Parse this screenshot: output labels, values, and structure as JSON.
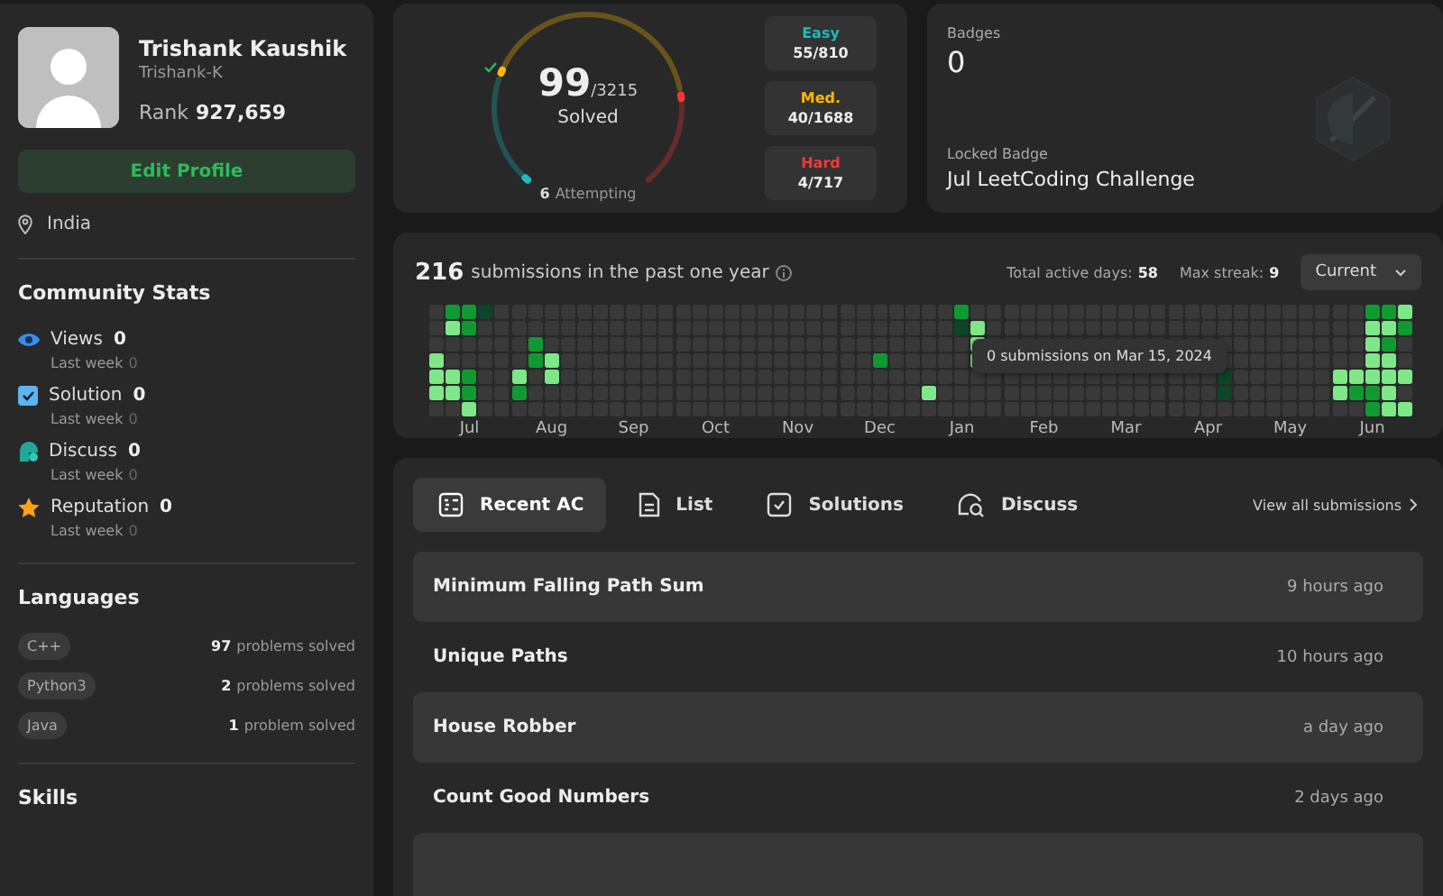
{
  "profile": {
    "name": "Trishank Kaushik",
    "username": "Trishank-K",
    "rank_label": "Rank",
    "rank": "927,659",
    "edit_button": "Edit Profile",
    "location": "India"
  },
  "community_stats": {
    "title": "Community Stats",
    "items": [
      {
        "kind": "views",
        "label": "Views",
        "value": "0",
        "sub_label": "Last week",
        "sub_value": "0"
      },
      {
        "kind": "solution",
        "label": "Solution",
        "value": "0",
        "sub_label": "Last week",
        "sub_value": "0"
      },
      {
        "kind": "discuss",
        "label": "Discuss",
        "value": "0",
        "sub_label": "Last week",
        "sub_value": "0"
      },
      {
        "kind": "reputation",
        "label": "Reputation",
        "value": "0",
        "sub_label": "Last week",
        "sub_value": "0"
      }
    ]
  },
  "languages": {
    "title": "Languages",
    "items": [
      {
        "name": "C++",
        "count": "97",
        "suffix": "problems solved"
      },
      {
        "name": "Python3",
        "count": "2",
        "suffix": "problems solved"
      },
      {
        "name": "Java",
        "count": "1",
        "suffix": "problem solved"
      }
    ]
  },
  "skills": {
    "title": "Skills"
  },
  "solved": {
    "count": "99",
    "total": "/3215",
    "label": "Solved",
    "attempting_count": "6",
    "attempting_label": "Attempting",
    "difficulties": [
      {
        "label": "Easy",
        "value": "55/810",
        "color": "#1cbbba"
      },
      {
        "label": "Med.",
        "value": "40/1688",
        "color": "#ffb800"
      },
      {
        "label": "Hard",
        "value": "4/717",
        "color": "#f63737"
      }
    ]
  },
  "badges": {
    "title": "Badges",
    "count": "0",
    "locked_label": "Locked Badge",
    "locked_name": "Jul LeetCoding Challenge"
  },
  "submissions": {
    "count": "216",
    "text": "submissions in the past one year",
    "active_days_label": "Total active days:",
    "active_days": "58",
    "max_streak_label": "Max streak:",
    "max_streak": "9",
    "period": "Current",
    "tooltip": "0 submissions on Mar 15, 2024",
    "months": [
      {
        "label": "Jul"
      },
      {
        "label": "Aug"
      },
      {
        "label": "Sep"
      },
      {
        "label": "Oct"
      },
      {
        "label": "Nov"
      },
      {
        "label": "Dec"
      },
      {
        "label": "Jan"
      },
      {
        "label": "Feb"
      },
      {
        "label": "Mar"
      },
      {
        "label": "Apr"
      },
      {
        "label": "May"
      },
      {
        "label": "Jun"
      }
    ]
  },
  "recent": {
    "tabs": [
      {
        "label": "Recent AC",
        "kind": "recent",
        "selected": true
      },
      {
        "label": "List",
        "kind": "list",
        "selected": false
      },
      {
        "label": "Solutions",
        "kind": "solutions",
        "selected": false
      },
      {
        "label": "Discuss",
        "kind": "discuss",
        "selected": false
      }
    ],
    "view_all": "View all submissions",
    "rows": [
      {
        "title": "Minimum Falling Path Sum",
        "time": "9 hours ago"
      },
      {
        "title": "Unique Paths",
        "time": "10 hours ago"
      },
      {
        "title": "House Robber",
        "time": "a day ago"
      },
      {
        "title": "Count Good Numbers",
        "time": "2 days ago"
      }
    ]
  }
}
